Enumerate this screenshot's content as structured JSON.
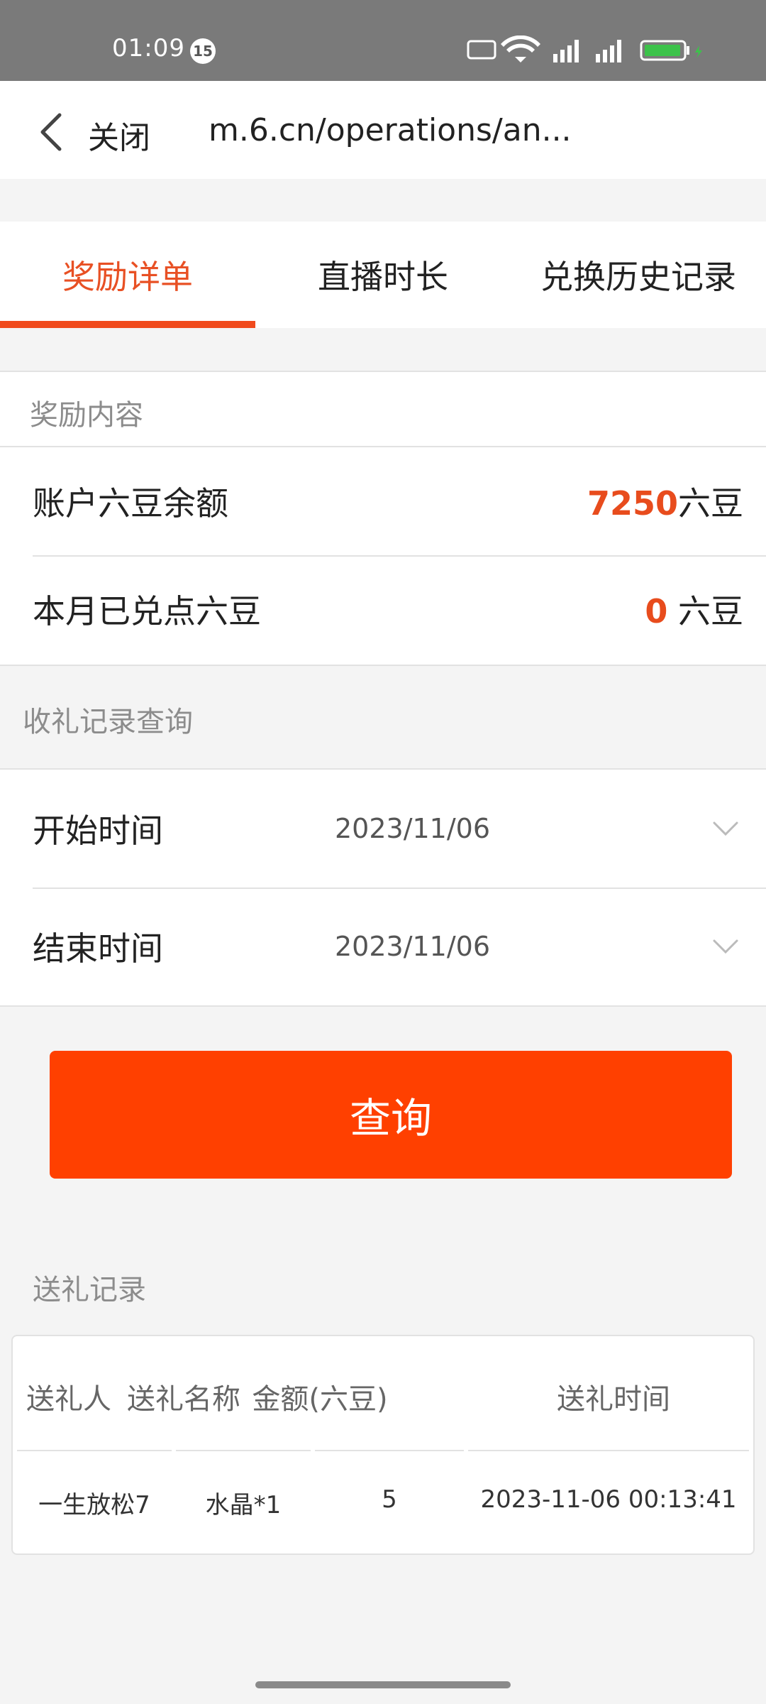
{
  "status": {
    "time": "01:09",
    "badge": "15"
  },
  "nav": {
    "close_label": "关闭",
    "url": "m.6.cn/operations/an..."
  },
  "tabs": [
    {
      "label": "奖励详单"
    },
    {
      "label": "直播时长"
    },
    {
      "label": "兑换历史记录"
    }
  ],
  "reward": {
    "section_title": "奖励内容",
    "balance_label": "账户六豆余额",
    "balance_value": "7250",
    "balance_unit": "六豆",
    "redeemed_label": "本月已兑点六豆",
    "redeemed_value": "0",
    "redeemed_unit": "六豆"
  },
  "query": {
    "section_title": "收礼记录查询",
    "start_label": "开始时间",
    "start_value": "2023/11/06",
    "end_label": "结束时间",
    "end_value": "2023/11/06",
    "button_label": "查询"
  },
  "gift_records": {
    "section_title": "送礼记录",
    "columns": [
      "送礼人",
      "送礼名称",
      "金额(六豆)",
      "送礼时间"
    ],
    "rows": [
      [
        "一生放松7",
        "水晶*1",
        "5",
        "2023-11-06 00:13:41"
      ]
    ]
  },
  "colors": {
    "accent": "#ff4000",
    "tab_active": "#e85024",
    "status_bar": "#7a7a7a"
  }
}
